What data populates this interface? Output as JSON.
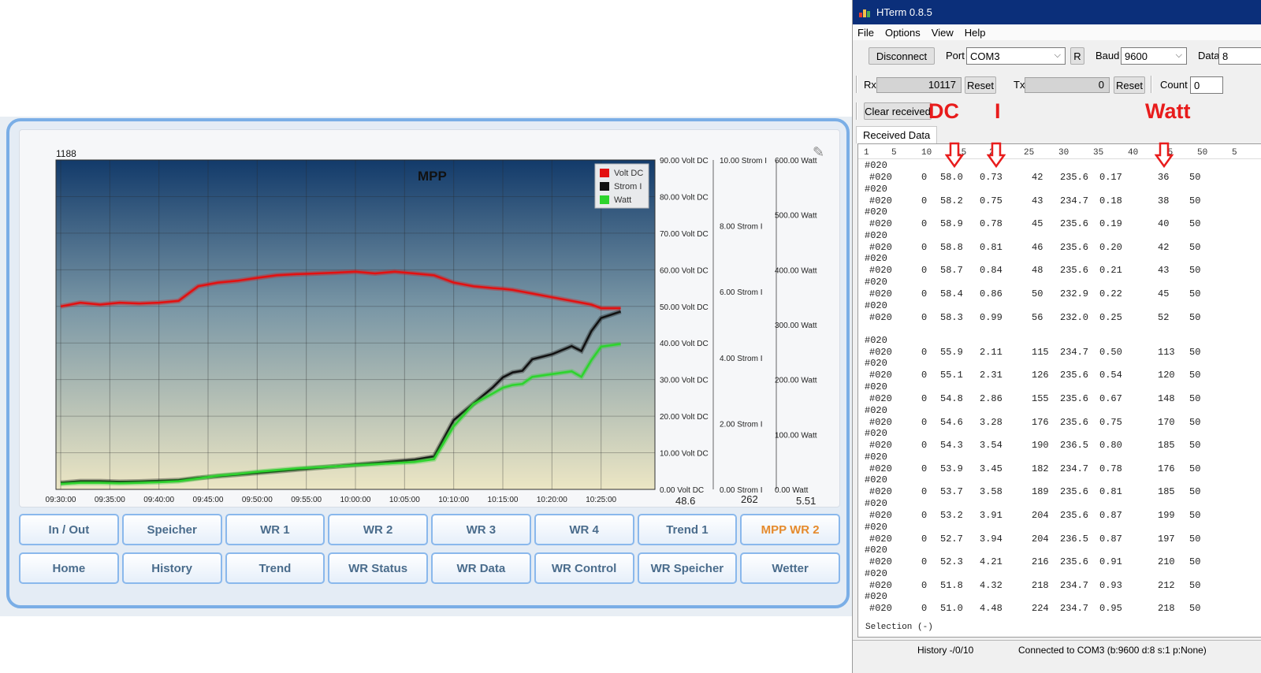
{
  "dashboard": {
    "counter": "1188",
    "chart_title": "MPP",
    "readouts": {
      "volt": "48.6",
      "strom": "262",
      "watt": "5.51"
    },
    "nav_row1": [
      {
        "label": "In / Out",
        "active": false
      },
      {
        "label": "Speicher",
        "active": false
      },
      {
        "label": "WR 1",
        "active": false
      },
      {
        "label": "WR 2",
        "active": false
      },
      {
        "label": "WR 3",
        "active": false
      },
      {
        "label": "WR 4",
        "active": false
      },
      {
        "label": "Trend 1",
        "active": false
      },
      {
        "label": "MPP WR 2",
        "active": true
      }
    ],
    "nav_row2": [
      {
        "label": "Home"
      },
      {
        "label": "History"
      },
      {
        "label": "Trend"
      },
      {
        "label": "WR Status"
      },
      {
        "label": "WR Data"
      },
      {
        "label": "WR Control"
      },
      {
        "label": "WR Speicher"
      },
      {
        "label": "Wetter"
      }
    ]
  },
  "chart_data": {
    "type": "line",
    "title": "MPP",
    "x": [
      "09:30:00",
      "09:32:00",
      "09:34:00",
      "09:36:00",
      "09:38:00",
      "09:40:00",
      "09:42:00",
      "09:44:00",
      "09:46:00",
      "09:48:00",
      "09:50:00",
      "09:52:00",
      "09:54:00",
      "09:56:00",
      "09:58:00",
      "10:00:00",
      "10:02:00",
      "10:04:00",
      "10:06:00",
      "10:08:00",
      "10:10:00",
      "10:12:00",
      "10:14:00",
      "10:15:00",
      "10:16:00",
      "10:17:00",
      "10:18:00",
      "10:20:00",
      "10:22:00",
      "10:23:00",
      "10:24:00",
      "10:25:00",
      "10:27:00"
    ],
    "x_tick_labels": [
      "09:30:00",
      "09:35:00",
      "09:40:00",
      "09:45:00",
      "09:50:00",
      "09:55:00",
      "10:00:00",
      "10:05:00",
      "10:10:00",
      "10:15:00",
      "10:20:00",
      "10:25:00"
    ],
    "y_axes": [
      {
        "name": "Volt DC",
        "range": [
          0,
          90
        ],
        "ticks": [
          "0.00 Volt DC",
          "10.00 Volt DC",
          "20.00 Volt DC",
          "30.00 Volt DC",
          "40.00 Volt DC",
          "50.00 Volt DC",
          "60.00 Volt DC",
          "70.00 Volt DC",
          "80.00 Volt DC",
          "90.00 Volt DC"
        ]
      },
      {
        "name": "Strom I",
        "range": [
          0,
          10
        ],
        "ticks": [
          "0.00 Strom I",
          "2.00 Strom I",
          "4.00 Strom I",
          "6.00 Strom I",
          "8.00 Strom I",
          "10.00 Strom I"
        ]
      },
      {
        "name": "Watt",
        "range": [
          0,
          600
        ],
        "ticks": [
          "0.00 Watt",
          "100.00 Watt",
          "200.00 Watt",
          "300.00 Watt",
          "400.00 Watt",
          "500.00 Watt",
          "600.00 Watt"
        ]
      }
    ],
    "series": [
      {
        "name": "Volt DC",
        "color": "#e31010",
        "axis": 0,
        "values": [
          50.0,
          51.0,
          50.5,
          51.0,
          50.8,
          51.0,
          51.5,
          55.5,
          56.5,
          57.0,
          57.8,
          58.5,
          58.8,
          59.0,
          59.2,
          59.5,
          59.0,
          59.5,
          59.0,
          58.5,
          56.5,
          55.5,
          55.0,
          54.8,
          54.5,
          54.0,
          53.5,
          52.5,
          51.5,
          51.0,
          50.5,
          49.5,
          49.5
        ]
      },
      {
        "name": "Strom I",
        "color": "#111111",
        "axis": 1,
        "values": [
          0.2,
          0.25,
          0.25,
          0.23,
          0.24,
          0.26,
          0.28,
          0.35,
          0.4,
          0.45,
          0.5,
          0.55,
          0.6,
          0.65,
          0.7,
          0.75,
          0.8,
          0.85,
          0.9,
          1.0,
          2.1,
          2.6,
          3.1,
          3.4,
          3.55,
          3.6,
          3.95,
          4.1,
          4.35,
          4.2,
          4.8,
          5.2,
          5.4
        ]
      },
      {
        "name": "Watt",
        "color": "#2dd42d",
        "axis": 2,
        "values": [
          10,
          12,
          12,
          11,
          12,
          13,
          15,
          20,
          25,
          28,
          32,
          35,
          38,
          40,
          42,
          44,
          46,
          48,
          50,
          55,
          115,
          155,
          175,
          185,
          190,
          192,
          205,
          210,
          215,
          205,
          235,
          260,
          265
        ]
      }
    ],
    "legend": {
      "position": "top-right",
      "entries": [
        "Volt DC",
        "Strom I",
        "Watt"
      ]
    },
    "grid": true
  },
  "hterm": {
    "title": "HTerm 0.8.5",
    "menu": [
      "File",
      "Options",
      "View",
      "Help"
    ],
    "disconnect_label": "Disconnect",
    "port_label": "Port",
    "port_value": "COM3",
    "r_label": "R",
    "baud_label": "Baud",
    "baud_value": "9600",
    "data_label": "Data",
    "data_value": "8",
    "rx_label": "Rx",
    "rx_value": "10117",
    "tx_label": "Tx",
    "tx_value": "0",
    "reset_label": "Reset",
    "count_label": "Count",
    "count_value": "0",
    "clear_label": "Clear received",
    "tab_label": "Received Data",
    "ruler": [
      "1",
      "5",
      "10",
      "15",
      "20",
      "25",
      "30",
      "35",
      "40",
      "45",
      "50",
      "5"
    ],
    "prefix": "#020",
    "rows": [
      {
        "c0": "0",
        "dc": "58.0",
        "i": "0.73",
        "p": "42",
        "v": "235.6",
        "f": "0.17",
        "w": "36",
        "hz": "50"
      },
      {
        "c0": "0",
        "dc": "58.2",
        "i": "0.75",
        "p": "43",
        "v": "234.7",
        "f": "0.18",
        "w": "38",
        "hz": "50"
      },
      {
        "c0": "0",
        "dc": "58.9",
        "i": "0.78",
        "p": "45",
        "v": "235.6",
        "f": "0.19",
        "w": "40",
        "hz": "50"
      },
      {
        "c0": "0",
        "dc": "58.8",
        "i": "0.81",
        "p": "46",
        "v": "235.6",
        "f": "0.20",
        "w": "42",
        "hz": "50"
      },
      {
        "c0": "0",
        "dc": "58.7",
        "i": "0.84",
        "p": "48",
        "v": "235.6",
        "f": "0.21",
        "w": "43",
        "hz": "50"
      },
      {
        "c0": "0",
        "dc": "58.4",
        "i": "0.86",
        "p": "50",
        "v": "232.9",
        "f": "0.22",
        "w": "45",
        "hz": "50"
      },
      {
        "c0": "0",
        "dc": "58.3",
        "i": "0.99",
        "p": "56",
        "v": "232.0",
        "f": "0.25",
        "w": "52",
        "hz": "50"
      },
      {
        "c0": "0",
        "dc": "55.9",
        "i": "2.11",
        "p": "115",
        "v": "234.7",
        "f": "0.50",
        "w": "113",
        "hz": "50"
      },
      {
        "c0": "0",
        "dc": "55.1",
        "i": "2.31",
        "p": "126",
        "v": "235.6",
        "f": "0.54",
        "w": "120",
        "hz": "50"
      },
      {
        "c0": "0",
        "dc": "54.8",
        "i": "2.86",
        "p": "155",
        "v": "235.6",
        "f": "0.67",
        "w": "148",
        "hz": "50"
      },
      {
        "c0": "0",
        "dc": "54.6",
        "i": "3.28",
        "p": "176",
        "v": "235.6",
        "f": "0.75",
        "w": "170",
        "hz": "50"
      },
      {
        "c0": "0",
        "dc": "54.3",
        "i": "3.54",
        "p": "190",
        "v": "236.5",
        "f": "0.80",
        "w": "185",
        "hz": "50"
      },
      {
        "c0": "0",
        "dc": "53.9",
        "i": "3.45",
        "p": "182",
        "v": "234.7",
        "f": "0.78",
        "w": "176",
        "hz": "50"
      },
      {
        "c0": "0",
        "dc": "53.7",
        "i": "3.58",
        "p": "189",
        "v": "235.6",
        "f": "0.81",
        "w": "185",
        "hz": "50"
      },
      {
        "c0": "0",
        "dc": "53.2",
        "i": "3.91",
        "p": "204",
        "v": "235.6",
        "f": "0.87",
        "w": "199",
        "hz": "50"
      },
      {
        "c0": "0",
        "dc": "52.7",
        "i": "3.94",
        "p": "204",
        "v": "236.5",
        "f": "0.87",
        "w": "197",
        "hz": "50"
      },
      {
        "c0": "0",
        "dc": "52.3",
        "i": "4.21",
        "p": "216",
        "v": "235.6",
        "f": "0.91",
        "w": "210",
        "hz": "50"
      },
      {
        "c0": "0",
        "dc": "51.8",
        "i": "4.32",
        "p": "218",
        "v": "234.7",
        "f": "0.93",
        "w": "212",
        "hz": "50"
      },
      {
        "c0": "0",
        "dc": "51.0",
        "i": "4.48",
        "p": "224",
        "v": "234.7",
        "f": "0.95",
        "w": "218",
        "hz": "50"
      }
    ],
    "selection": "Selection (-)",
    "history": "History -/0/10",
    "status": "Connected to COM3 (b:9600 d:8 s:1 p:None)"
  },
  "annotations": {
    "dc": "DC",
    "i": "I",
    "watt": "Watt",
    "color": "#e81c1c"
  }
}
